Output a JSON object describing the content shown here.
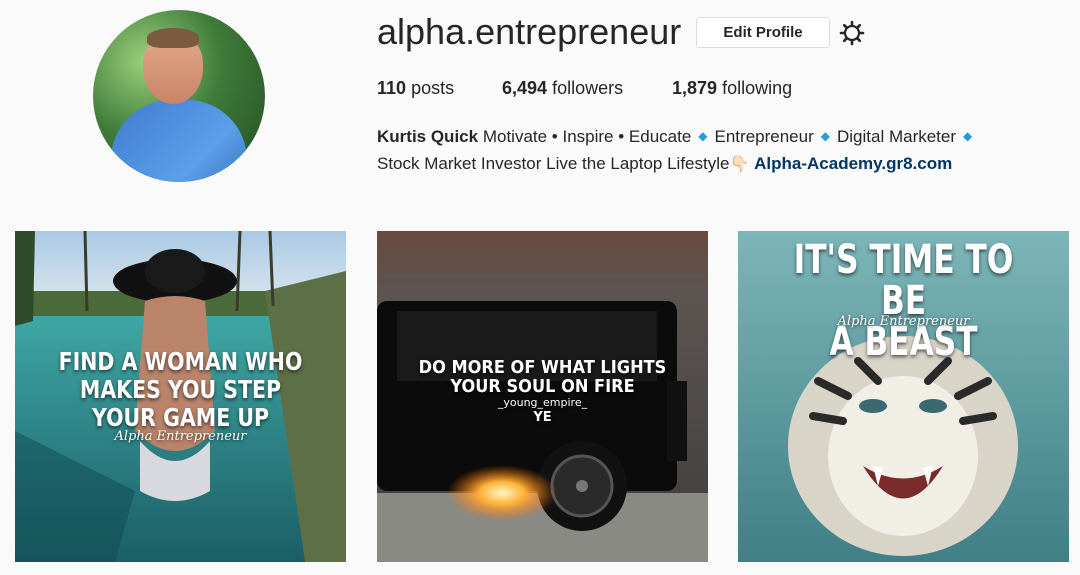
{
  "profile": {
    "username": "alpha.entrepreneur",
    "edit_profile_label": "Edit Profile",
    "settings_icon": "gear-icon",
    "avatar_icon": "profile-photo"
  },
  "stats": {
    "posts_count": "110",
    "posts_label": "posts",
    "followers_count": "6,494",
    "followers_label": "followers",
    "following_count": "1,879",
    "following_label": "following"
  },
  "bio": {
    "name": "Kurtis Quick",
    "line1_text": "Motivate • Inspire • Educate",
    "item_entrepreneur": "Entrepreneur",
    "item_digital_marketer": "Digital Marketer",
    "line2_text": "Stock Market Investor Live the Laptop Lifestyle",
    "hand_emoji": "👇🏻",
    "link": "Alpha-Academy.gr8.com",
    "diamond": "◆"
  },
  "posts": [
    {
      "line1": "FIND A WOMAN WHO",
      "line2": "MAKES YOU STEP",
      "line3": "YOUR GAME UP",
      "signature": "Alpha Entrepreneur"
    },
    {
      "line1": "DO MORE OF WHAT LIGHTS",
      "line2": "YOUR SOUL ON FIRE",
      "credit": "_young_empire_",
      "mark": "YE"
    },
    {
      "line1": "IT'S TIME TO BE",
      "line2": "A BEAST",
      "signature": "Alpha Entrepreneur"
    }
  ],
  "colors": {
    "link": "#003569",
    "diamond": "#2a9bd9",
    "background": "#fafafa"
  }
}
